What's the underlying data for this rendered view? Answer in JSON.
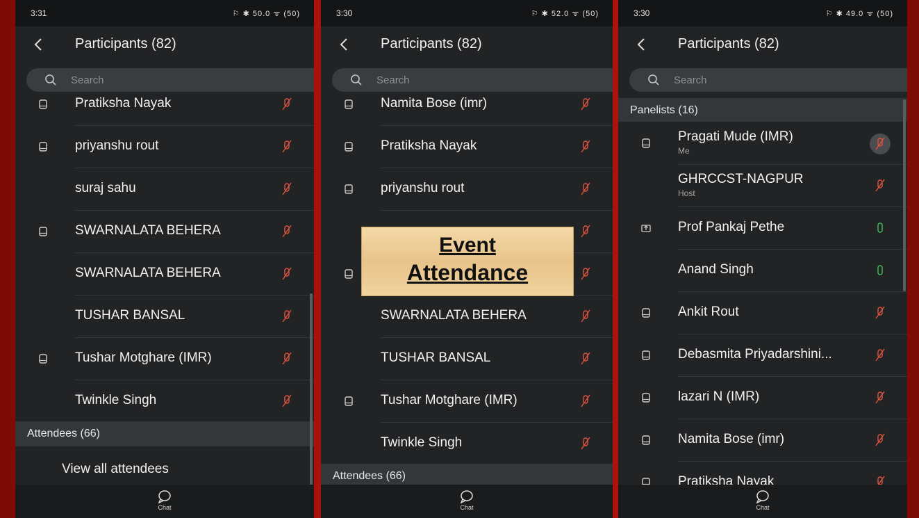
{
  "screens": [
    {
      "status_time": "3:31",
      "status_icons": "⚐ ✱ 50.0 ᯤ (50)",
      "title": "Participants (82)",
      "search_placeholder": "Search",
      "rows": [
        {
          "name": "Pratiksha Nayak",
          "device": "phone",
          "mic": "muted"
        },
        {
          "name": "priyanshu rout",
          "device": "phone",
          "mic": "muted"
        },
        {
          "name": "suraj sahu",
          "device": "none",
          "mic": "muted"
        },
        {
          "name": "SWARNALATA BEHERA",
          "device": "phone",
          "mic": "muted"
        },
        {
          "name": "SWARNALATA BEHERA",
          "device": "none",
          "mic": "muted"
        },
        {
          "name": "TUSHAR BANSAL",
          "device": "none",
          "mic": "muted"
        },
        {
          "name": "Tushar Motghare (IMR)",
          "device": "phone",
          "mic": "muted"
        },
        {
          "name": "Twinkle Singh",
          "device": "none",
          "mic": "muted"
        }
      ],
      "attendees_label": "Attendees (66)",
      "view_all": "View all attendees",
      "chat_label": "Chat"
    },
    {
      "status_time": "3:30",
      "status_icons": "⚐ ✱ 52.0 ᯤ (50)",
      "title": "Participants (82)",
      "search_placeholder": "Search",
      "rows": [
        {
          "name": "Namita Bose (imr)",
          "device": "phone",
          "mic": "muted"
        },
        {
          "name": "Pratiksha Nayak",
          "device": "phone",
          "mic": "muted"
        },
        {
          "name": "priyanshu rout",
          "device": "phone",
          "mic": "muted"
        },
        {
          "name": "",
          "device": "none",
          "mic": "muted"
        },
        {
          "name": "",
          "device": "phone",
          "mic": "muted"
        },
        {
          "name": "SWARNALATA BEHERA",
          "device": "none",
          "mic": "muted"
        },
        {
          "name": "TUSHAR BANSAL",
          "device": "none",
          "mic": "muted"
        },
        {
          "name": "Tushar Motghare (IMR)",
          "device": "phone",
          "mic": "muted"
        },
        {
          "name": "Twinkle Singh",
          "device": "none",
          "mic": "muted"
        }
      ],
      "attendees_label": "Attendees (66)",
      "chat_label": "Chat",
      "overlay": {
        "line1": "Event",
        "line2": "Attendance"
      }
    },
    {
      "status_time": "3:30",
      "status_icons": "⚐ ✱ 49.0 ᯤ (50)",
      "title": "Participants (82)",
      "search_placeholder": "Search",
      "panelists_label": "Panelists (16)",
      "rows": [
        {
          "name": "Pragati Mude (IMR)",
          "role": "Me",
          "device": "phone",
          "mic": "muted-circled"
        },
        {
          "name": "GHRCCST-NAGPUR",
          "role": "Host",
          "device": "none",
          "mic": "muted"
        },
        {
          "name": "Prof Pankaj Pethe",
          "device": "share",
          "mic": "on"
        },
        {
          "name": "Anand Singh",
          "device": "none",
          "mic": "on"
        },
        {
          "name": "Ankit Rout",
          "device": "phone",
          "mic": "muted"
        },
        {
          "name": "Debasmita Priyadarshini...",
          "device": "phone",
          "mic": "muted"
        },
        {
          "name": "lazari N (IMR)",
          "device": "phone",
          "mic": "muted"
        },
        {
          "name": "Namita Bose (imr)",
          "device": "phone",
          "mic": "muted"
        },
        {
          "name": "Pratiksha Nayak",
          "device": "phone",
          "mic": "muted"
        }
      ],
      "chat_label": "Chat"
    }
  ],
  "colors": {
    "muted_mic": "#e0533f",
    "active_mic": "#3fbf5a",
    "panel_bg": "#212325",
    "section_bg": "#34373a",
    "frame_red": "#c8160e"
  },
  "icons": {
    "back": "chevron-left-icon",
    "search": "search-icon",
    "phone": "phone-device-icon",
    "share": "screen-share-icon",
    "mic_muted": "mic-muted-icon",
    "mic_on": "mic-icon",
    "chat": "chat-bubble-icon"
  }
}
